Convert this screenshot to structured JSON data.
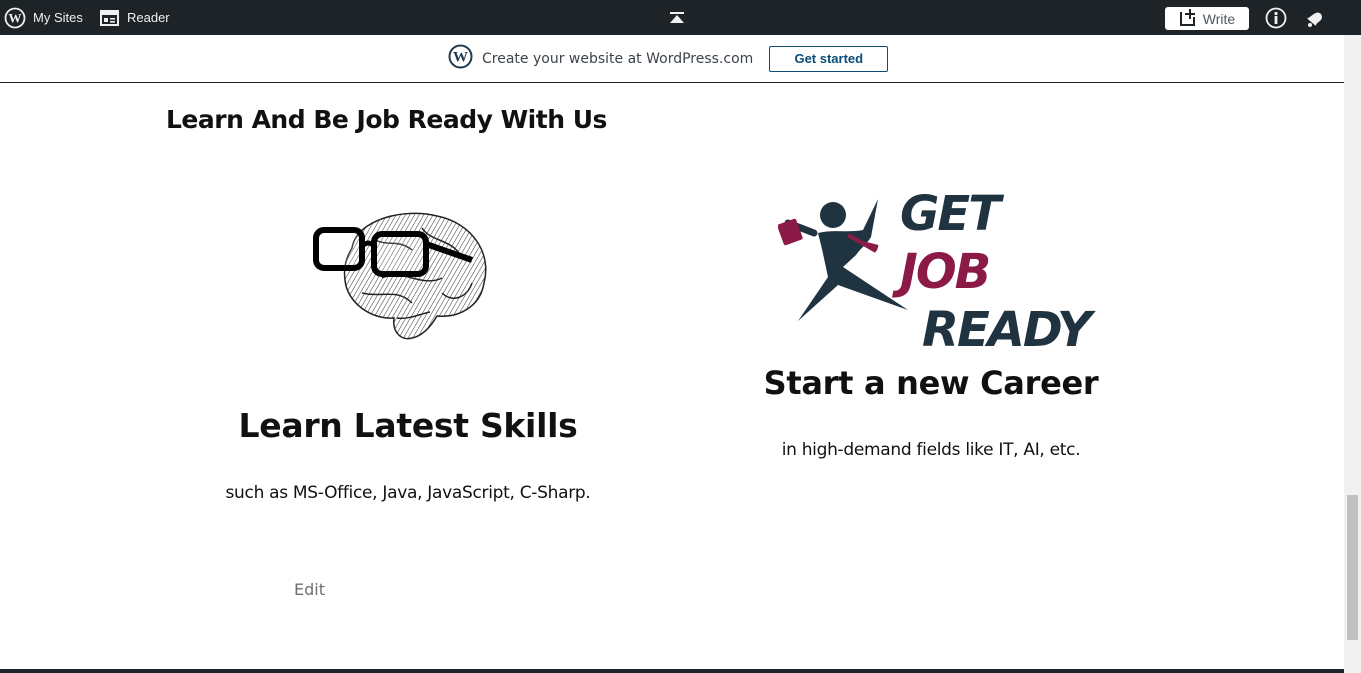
{
  "adminbar": {
    "my_sites": "My Sites",
    "reader": "Reader",
    "write": "Write"
  },
  "banner": {
    "text": "Create your website at WordPress.com",
    "cta": "Get started"
  },
  "content": {
    "section_title": "Learn And Be Job Ready With Us",
    "col1": {
      "heading": "Learn Latest Skills",
      "text": "such as MS-Office, Java, JavaScript, C-Sharp."
    },
    "col2": {
      "logo_line1_a": "GET",
      "logo_line1_b": "JOB",
      "logo_line2": "READY",
      "heading": "Start a new Career",
      "text": "in high-demand fields like IT, AI, etc."
    },
    "edit": "Edit"
  },
  "colors": {
    "adminbar_bg": "#1d2327",
    "logo_navy": "#1f3340",
    "logo_maroon": "#8b1a46",
    "cta_blue": "#0a4b78"
  }
}
